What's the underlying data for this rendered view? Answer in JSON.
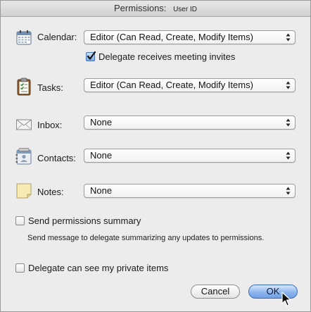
{
  "window": {
    "title": "Permissions:",
    "user": "User ID"
  },
  "rows": {
    "calendar": {
      "label": "Calendar:",
      "value": "Editor (Can Read, Create, Modify Items)",
      "icon": "calendar-icon"
    },
    "tasks": {
      "label": "Tasks:",
      "value": "Editor (Can Read, Create, Modify Items)",
      "icon": "clipboard-icon"
    },
    "inbox": {
      "label": "Inbox:",
      "value": "None",
      "icon": "envelope-icon"
    },
    "contacts": {
      "label": "Contacts:",
      "value": "None",
      "icon": "contacts-icon"
    },
    "notes": {
      "label": "Notes:",
      "value": "None",
      "icon": "note-icon"
    }
  },
  "options": {
    "delegate_invites": {
      "label": "Delegate receives meeting invites",
      "checked": true
    },
    "send_summary": {
      "label": "Send permissions summary",
      "checked": false
    },
    "send_summary_hint": "Send message to delegate summarizing any updates to permissions.",
    "private_items": {
      "label": "Delegate can see my private items",
      "checked": false
    }
  },
  "buttons": {
    "cancel": "Cancel",
    "ok": "OK"
  },
  "colors": {
    "background": "#ececec",
    "default_button": "#8fb7ee",
    "checkbox_checked": "#7aa8e6"
  }
}
